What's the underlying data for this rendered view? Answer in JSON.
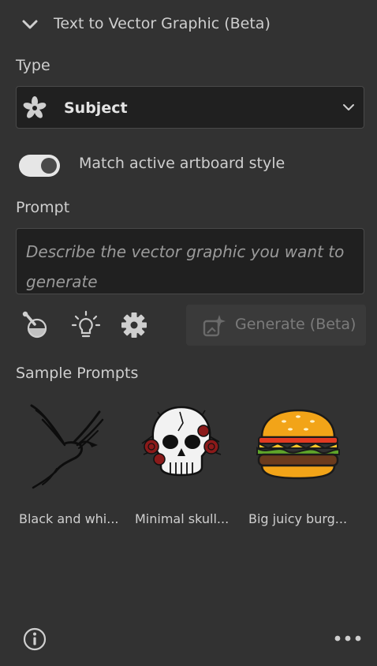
{
  "header": {
    "title": "Text to Vector Graphic (Beta)",
    "icon": "chevron-down-icon"
  },
  "type": {
    "label": "Type",
    "selected": "Subject",
    "icon": "subject-icon"
  },
  "style_toggle": {
    "label": "Match active artboard style",
    "on": true
  },
  "prompt": {
    "label": "Prompt",
    "value": "",
    "placeholder": "Describe the vector graphic you want to generate"
  },
  "tools": [
    "eyedropper-style-icon",
    "lightbulb-icon",
    "gear-icon"
  ],
  "generate": {
    "label": "Generate (Beta)",
    "enabled": false,
    "icon": "generate-sparkle-icon"
  },
  "samples": {
    "label": "Sample Prompts",
    "items": [
      {
        "caption": "Black and whi...",
        "image": "bird-illustration"
      },
      {
        "caption": "Minimal skull...",
        "image": "skull-with-roses-illustration"
      },
      {
        "caption": "Big juicy burg...",
        "image": "burger-illustration"
      }
    ]
  },
  "footer": {
    "info_icon": "info-icon",
    "more_icon": "more-icon"
  },
  "colors": {
    "background": "#323232",
    "field": "#202020",
    "border": "#494949",
    "text": "#cfcfcf",
    "disabled_text": "#7b7b7b"
  }
}
